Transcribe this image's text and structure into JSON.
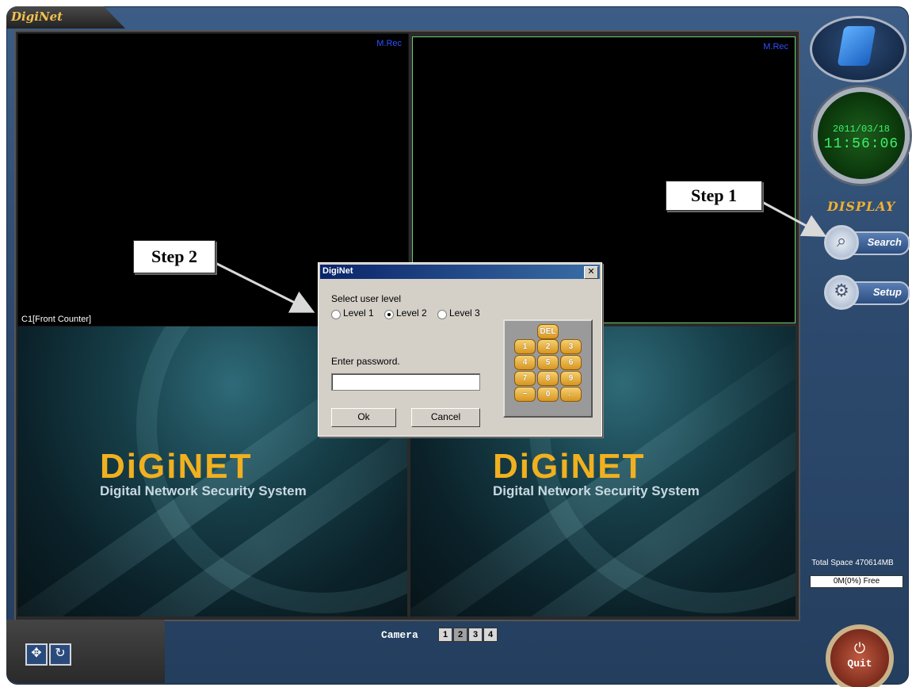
{
  "app": {
    "title": "DigiNet"
  },
  "cameras": {
    "cam1": {
      "status": "M.Rec",
      "label": "C1[Front Counter]"
    },
    "cam2": {
      "status": "M.Rec"
    },
    "cam3": {
      "logo": "DiGiNET",
      "tagline": "Digital Network Security System"
    },
    "cam4": {
      "logo": "DiGiNET",
      "tagline": "Digital Network Security System"
    }
  },
  "clock": {
    "date": "2011/03/18",
    "time": "11:56:06"
  },
  "display_panel": {
    "title": "DISPLAY",
    "search_label": "Search",
    "setup_label": "Setup"
  },
  "storage": {
    "total": "Total Space 470614MB",
    "free": "0M(0%) Free"
  },
  "quit": {
    "label": "Quit",
    "icon": "power-icon"
  },
  "bottom": {
    "camera_label": "Camera",
    "cameras": [
      "1",
      "2",
      "3",
      "4"
    ],
    "selected": "2"
  },
  "dialog": {
    "title": "DigiNet",
    "close": "✕",
    "prompt": "Select user level",
    "levels": [
      "Level 1",
      "Level 2",
      "Level 3"
    ],
    "selected_level": "Level 2",
    "password_label": "Enter password.",
    "password_value": "",
    "ok_label": "Ok",
    "cancel_label": "Cancel",
    "keypad": {
      "del": "DEL",
      "keys": [
        "1",
        "2",
        "3",
        "4",
        "5",
        "6",
        "7",
        "8",
        "9",
        "−",
        "0",
        "←"
      ]
    }
  },
  "annotations": {
    "step1": "Step 1",
    "step2": "Step 2"
  }
}
